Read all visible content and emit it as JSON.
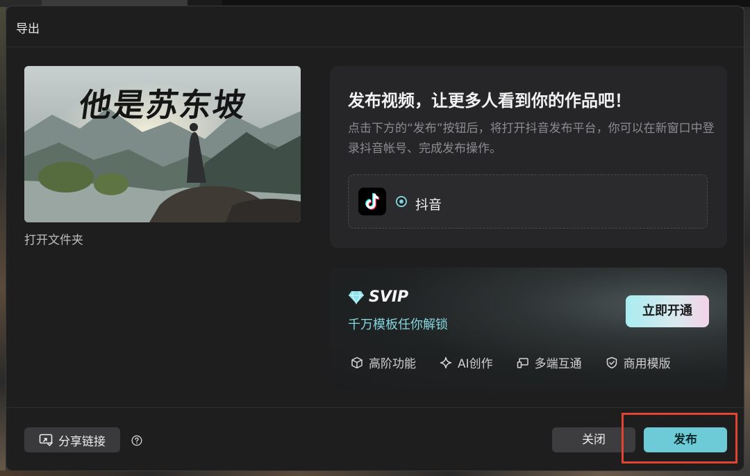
{
  "dialog": {
    "title": "导出"
  },
  "preview": {
    "title_text": "他是苏东坡",
    "open_folder_label": "打开文件夹"
  },
  "publish": {
    "heading": "发布视频，让更多人看到你的作品吧！",
    "description": "点击下方的“发布”按钮后，将打开抖音发布平台，你可以在新窗口中登录抖音帐号、完成发布操作。",
    "platform": {
      "name": "抖音",
      "icon": "tiktok-icon",
      "selected": true
    }
  },
  "svip": {
    "label": "SVIP",
    "subtitle": "千万模板任你解锁",
    "cta_label": "立即开通",
    "features": [
      {
        "label": "高阶功能",
        "icon": "cube-icon"
      },
      {
        "label": "AI创作",
        "icon": "sparkle-icon"
      },
      {
        "label": "多端互通",
        "icon": "devices-icon"
      },
      {
        "label": "商用模版",
        "icon": "shield-check-icon"
      }
    ]
  },
  "footer": {
    "share_label": "分享链接",
    "close_label": "关闭",
    "publish_label": "发布"
  },
  "colors": {
    "accent": "#6ccbd6",
    "highlight": "#e2452f",
    "dialog_bg": "#1e1e1f"
  }
}
